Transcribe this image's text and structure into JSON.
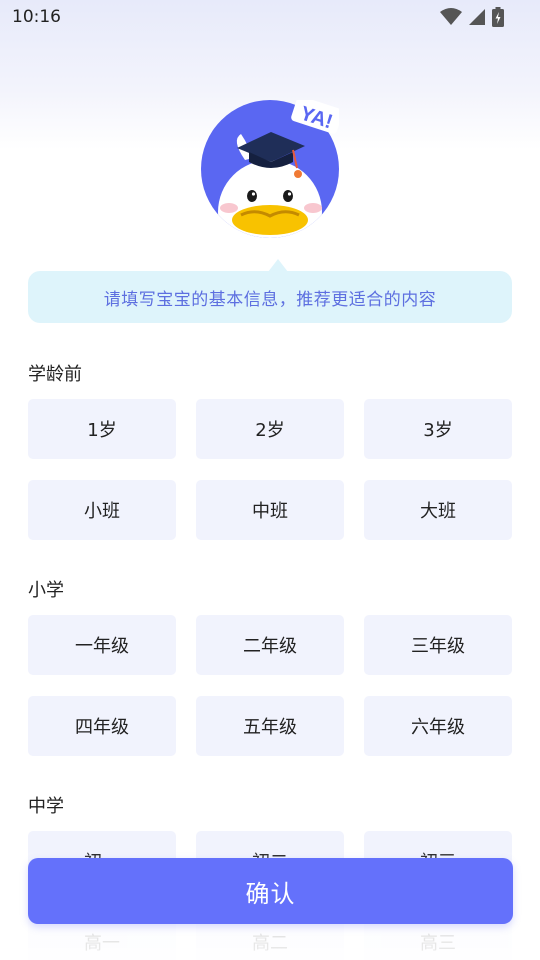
{
  "status_bar": {
    "time": "10:16"
  },
  "mascot": {
    "sticker_text": "YA!"
  },
  "tip": {
    "text": "请填写宝宝的基本信息，推荐更适合的内容"
  },
  "sections": [
    {
      "title": "学龄前",
      "options": [
        "1岁",
        "2岁",
        "3岁",
        "小班",
        "中班",
        "大班"
      ]
    },
    {
      "title": "小学",
      "options": [
        "一年级",
        "二年级",
        "三年级",
        "四年级",
        "五年级",
        "六年级"
      ]
    },
    {
      "title": "中学",
      "options": [
        "初一",
        "初二",
        "初三",
        "高一",
        "高二",
        "高三"
      ]
    }
  ],
  "confirm_label": "确认",
  "colors": {
    "primary": "#6471fb",
    "tip_bg": "#def4fb",
    "tip_text": "#5d6fe0",
    "option_bg": "#f1f3fd"
  }
}
